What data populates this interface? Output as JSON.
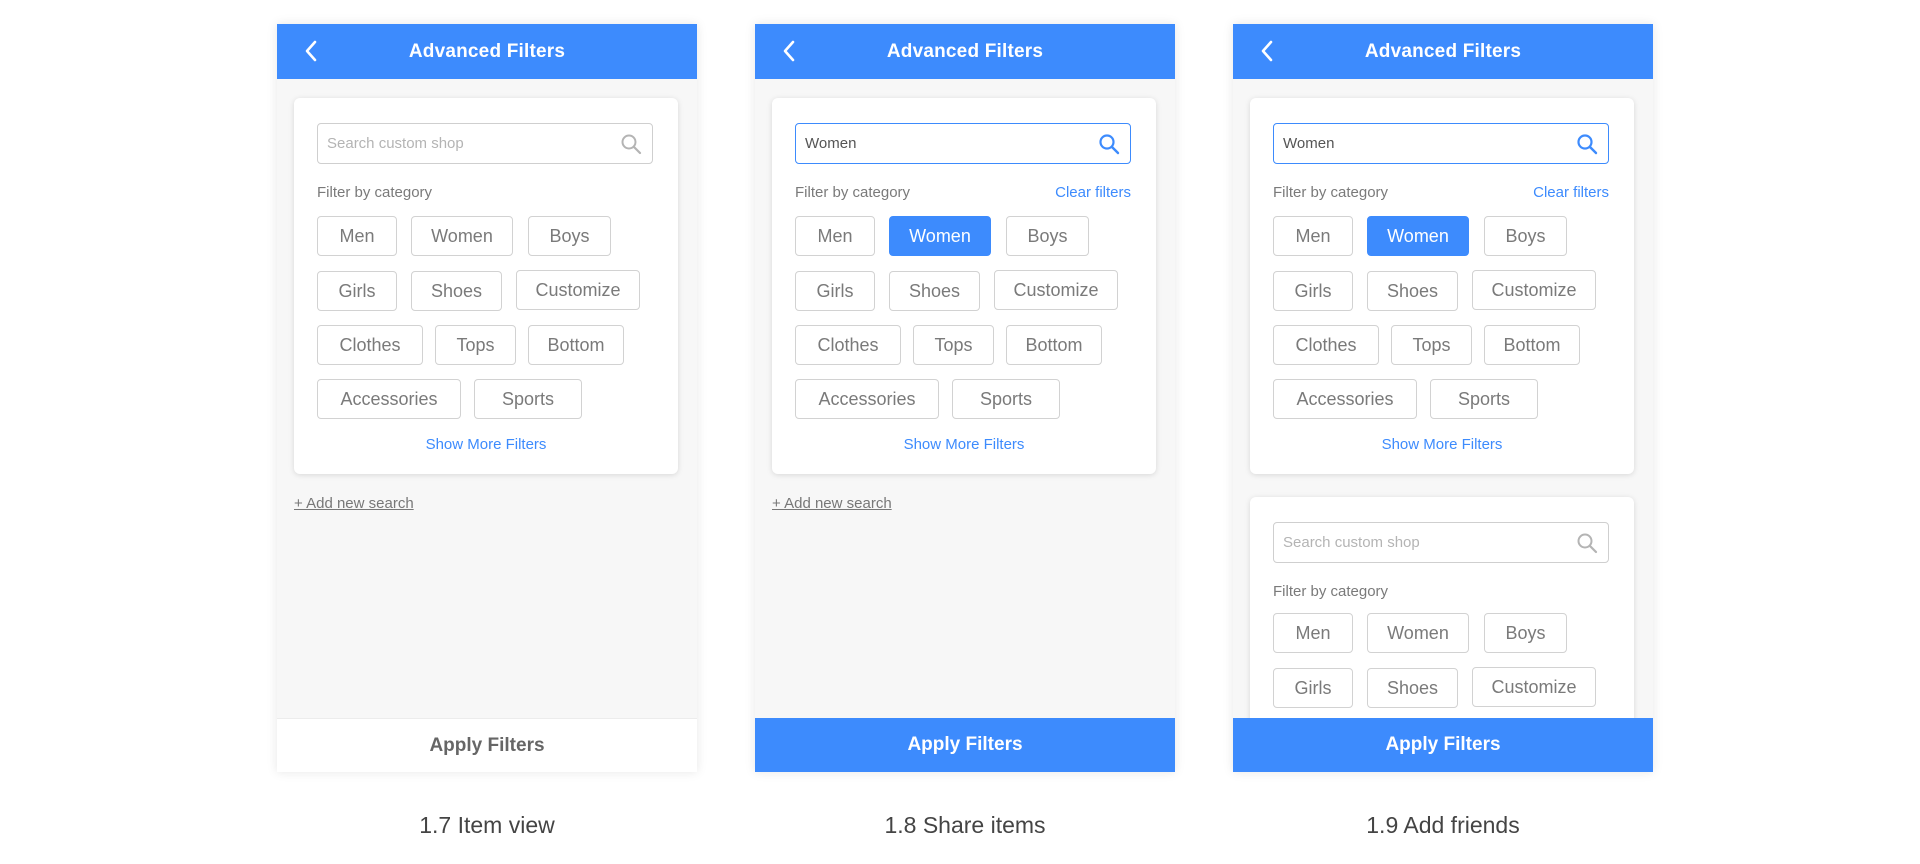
{
  "screens": [
    {
      "header_title": "Advanced Filters",
      "search_value": "",
      "search_placeholder": "Search custom shop",
      "filter_label": "Filter by category",
      "clear_label": "",
      "chips": [
        "Men",
        "Women",
        "Boys",
        "Girls",
        "Shoes",
        "Customize",
        "Clothes",
        "Tops",
        "Bottom",
        "Accessories",
        "Sports"
      ],
      "selected_chip": "",
      "show_more": "Show More Filters",
      "add_search": "+ Add new search",
      "apply_label": "Apply Filters",
      "caption": "1.7 Item view"
    },
    {
      "header_title": "Advanced Filters",
      "search_value": "Women",
      "search_placeholder": "Search custom shop",
      "filter_label": "Filter by category",
      "clear_label": "Clear filters",
      "chips": [
        "Men",
        "Women",
        "Boys",
        "Girls",
        "Shoes",
        "Customize",
        "Clothes",
        "Tops",
        "Bottom",
        "Accessories",
        "Sports"
      ],
      "selected_chip": "Women",
      "show_more": "Show More Filters",
      "add_search": "+ Add new search",
      "apply_label": "Apply Filters",
      "caption": "1.8 Share items"
    },
    {
      "header_title": "Advanced Filters",
      "search_value": "Women",
      "search_placeholder": "Search custom shop",
      "filter_label": "Filter by category",
      "clear_label": "Clear filters",
      "chips": [
        "Men",
        "Women",
        "Boys",
        "Girls",
        "Shoes",
        "Customize",
        "Clothes",
        "Tops",
        "Bottom",
        "Accessories",
        "Sports"
      ],
      "selected_chip": "Women",
      "show_more": "Show More Filters",
      "second_card": {
        "search_value": "",
        "search_placeholder": "Search custom shop",
        "filter_label": "Filter by category",
        "chips": [
          "Men",
          "Women",
          "Boys",
          "Girls",
          "Shoes",
          "Customize"
        ]
      },
      "apply_label": "Apply Filters",
      "caption": "1.9 Add friends"
    }
  ],
  "colors": {
    "accent": "#3d8bfd",
    "chip_border": "#d2d2d2",
    "muted_text": "#7a7a7a",
    "panel_bg": "#f7f7f7"
  },
  "icons": {
    "back": "chevron-left-icon",
    "search": "search-icon"
  }
}
